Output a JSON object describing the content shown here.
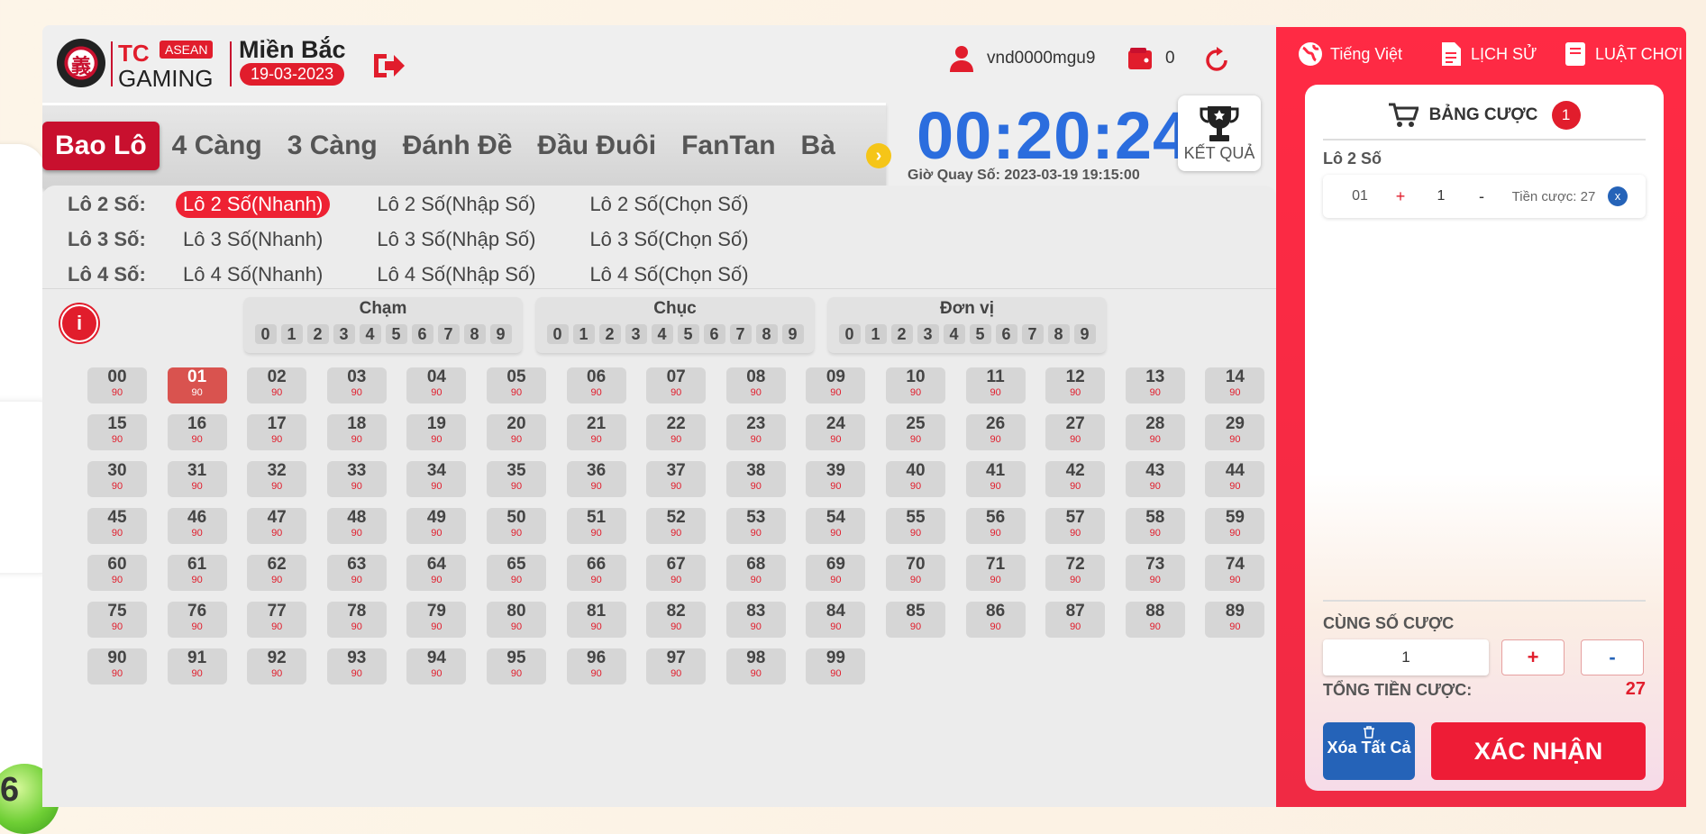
{
  "header": {
    "brand_tc": "TC",
    "brand_asean": "ASEAN",
    "brand_gaming": "GAMING",
    "logo_glyph": "義",
    "region": "Miền Bắc",
    "date": "19-03-2023",
    "username": "vnd0000mgu9",
    "balance": "0"
  },
  "game_tabs": [
    {
      "label": "Bao Lô",
      "active": true
    },
    {
      "label": "4 Càng",
      "active": false
    },
    {
      "label": "3 Càng",
      "active": false
    },
    {
      "label": "Đánh Đề",
      "active": false
    },
    {
      "label": "Đầu Đuôi",
      "active": false
    },
    {
      "label": "FanTan",
      "active": false
    },
    {
      "label": "Bà",
      "active": false
    }
  ],
  "timer": {
    "countdown": "00:20:24",
    "draw_time": "Giờ Quay Số: 2023-03-19 19:15:00",
    "result_label": "KẾT QUẢ"
  },
  "sub_types": [
    {
      "label": "Lô 2 Số:",
      "options": [
        "Lô 2 Số(Nhanh)",
        "Lô 2 Số(Nhập Số)",
        "Lô 2 Số(Chọn Số)"
      ],
      "active": 0
    },
    {
      "label": "Lô 3 Số:",
      "options": [
        "Lô 3 Số(Nhanh)",
        "Lô 3 Số(Nhập Số)",
        "Lô 3 Số(Chọn Số)"
      ],
      "active": -1
    },
    {
      "label": "Lô 4 Số:",
      "options": [
        "Lô 4 Số(Nhanh)",
        "Lô 4 Số(Nhập Số)",
        "Lô 4 Số(Chọn Số)"
      ],
      "active": -1
    }
  ],
  "digit_groups": [
    {
      "title": "Chạm",
      "digits": [
        "0",
        "1",
        "2",
        "3",
        "4",
        "5",
        "6",
        "7",
        "8",
        "9"
      ]
    },
    {
      "title": "Chục",
      "digits": [
        "0",
        "1",
        "2",
        "3",
        "4",
        "5",
        "6",
        "7",
        "8",
        "9"
      ]
    },
    {
      "title": "Đơn vị",
      "digits": [
        "0",
        "1",
        "2",
        "3",
        "4",
        "5",
        "6",
        "7",
        "8",
        "9"
      ]
    }
  ],
  "number_grid": {
    "odds": "90",
    "selected": [
      "01"
    ]
  },
  "right_nav": {
    "language": "Tiếng Việt",
    "history": "LỊCH SỬ",
    "rules": "LUẬT CHƠI"
  },
  "bet_slip": {
    "title": "BẢNG CƯỢC",
    "count": "1",
    "section": "Lô 2 Số",
    "items": [
      {
        "number": "01",
        "plus": "+",
        "qty": "1",
        "minus": "-",
        "cost": "Tiền cược: 27",
        "remove": "x"
      }
    ],
    "same_bet_label": "CÙNG SỐ CƯỢC",
    "same_bet_value": "1",
    "plus": "+",
    "minus": "-",
    "total_label": "TỔNG TIỀN CƯỢC:",
    "total_value": "27",
    "clear_label": "Xóa Tất Cả",
    "confirm_label": "XÁC NHẬN"
  },
  "ball_number": "6",
  "colors": {
    "brand_red": "#e11d2c",
    "timer_blue": "#2b6dde",
    "panel_red": "#ff2a44",
    "clear_blue": "#2563b8"
  }
}
